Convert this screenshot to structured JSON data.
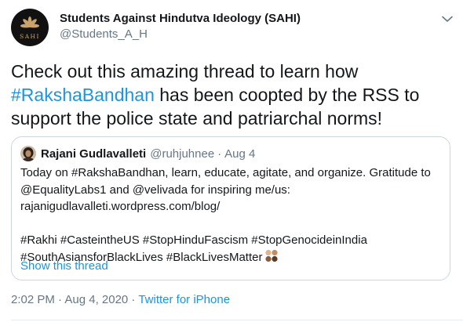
{
  "author": {
    "display_name": "Students Against Hindutva Ideology (SAHI)",
    "handle": "@Students_A_H",
    "avatar_text": "SAHI"
  },
  "tweet": {
    "text_before": "Check out this amazing thread to learn how",
    "hashtag": "#RakshaBandhan",
    "text_after": " has been coopted by the RSS to support the police state and patriarchal norms!"
  },
  "quoted_tweet": {
    "name": "Rajani Gudlavalleti",
    "handle": "@ruhjuhnee",
    "separator": "·",
    "date": "Aug 4",
    "lines": [
      "Today on #RakshaBandhan, learn, educate, agitate, and organize. Gratitude to",
      "@EqualityLabs1 and @velivada for inspiring me/us:",
      "rajanigudlavalleti.wordpress.com/blog/"
    ],
    "hashtag_lines": [
      "#Rakhi #CasteintheUS #StopHinduFascism #StopGenocideinIndia",
      "#SouthAsiansforBlackLives #BlackLivesMatter"
    ],
    "show_thread": "Show this thread"
  },
  "meta": {
    "timestamp": "2:02 PM · Aug 4, 2020 · ",
    "source": "Twitter for iPhone"
  },
  "colors": {
    "link": "#1b95e0",
    "secondary": "#657786",
    "text": "#14171a",
    "border": "#ccd6dd"
  },
  "icons": {
    "caret": "chevron-down-icon",
    "avatar_logo": "lotus-logo-icon",
    "emoji": "skin-tone-dots-emoji"
  }
}
